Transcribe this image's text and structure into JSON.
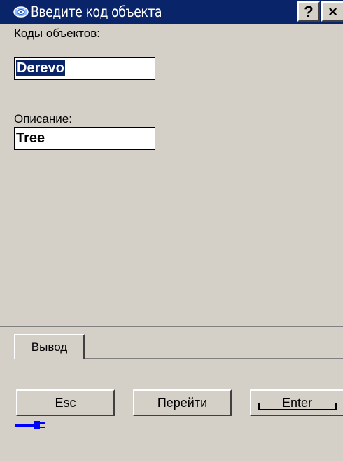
{
  "window": {
    "title": "Введите код объекта",
    "help_label": "?",
    "close_label": "×"
  },
  "form": {
    "codes_label": "Коды объектов:",
    "code_value": "Derevo",
    "description_label": "Описание:",
    "description_value": "Tree"
  },
  "tabs": [
    {
      "label": "Вывод"
    }
  ],
  "buttons": {
    "esc_label": "Esc",
    "go_label_prefix": "П",
    "go_label_accel": "е",
    "go_label_suffix": "рейти",
    "enter_label": "Enter"
  },
  "status": {
    "connection_icon": "plug-connected-icon",
    "accent_color": "#0000ff"
  },
  "colors": {
    "titlebar": "#0a246a",
    "background": "#d4d0c8",
    "selection": "#0a246a"
  }
}
